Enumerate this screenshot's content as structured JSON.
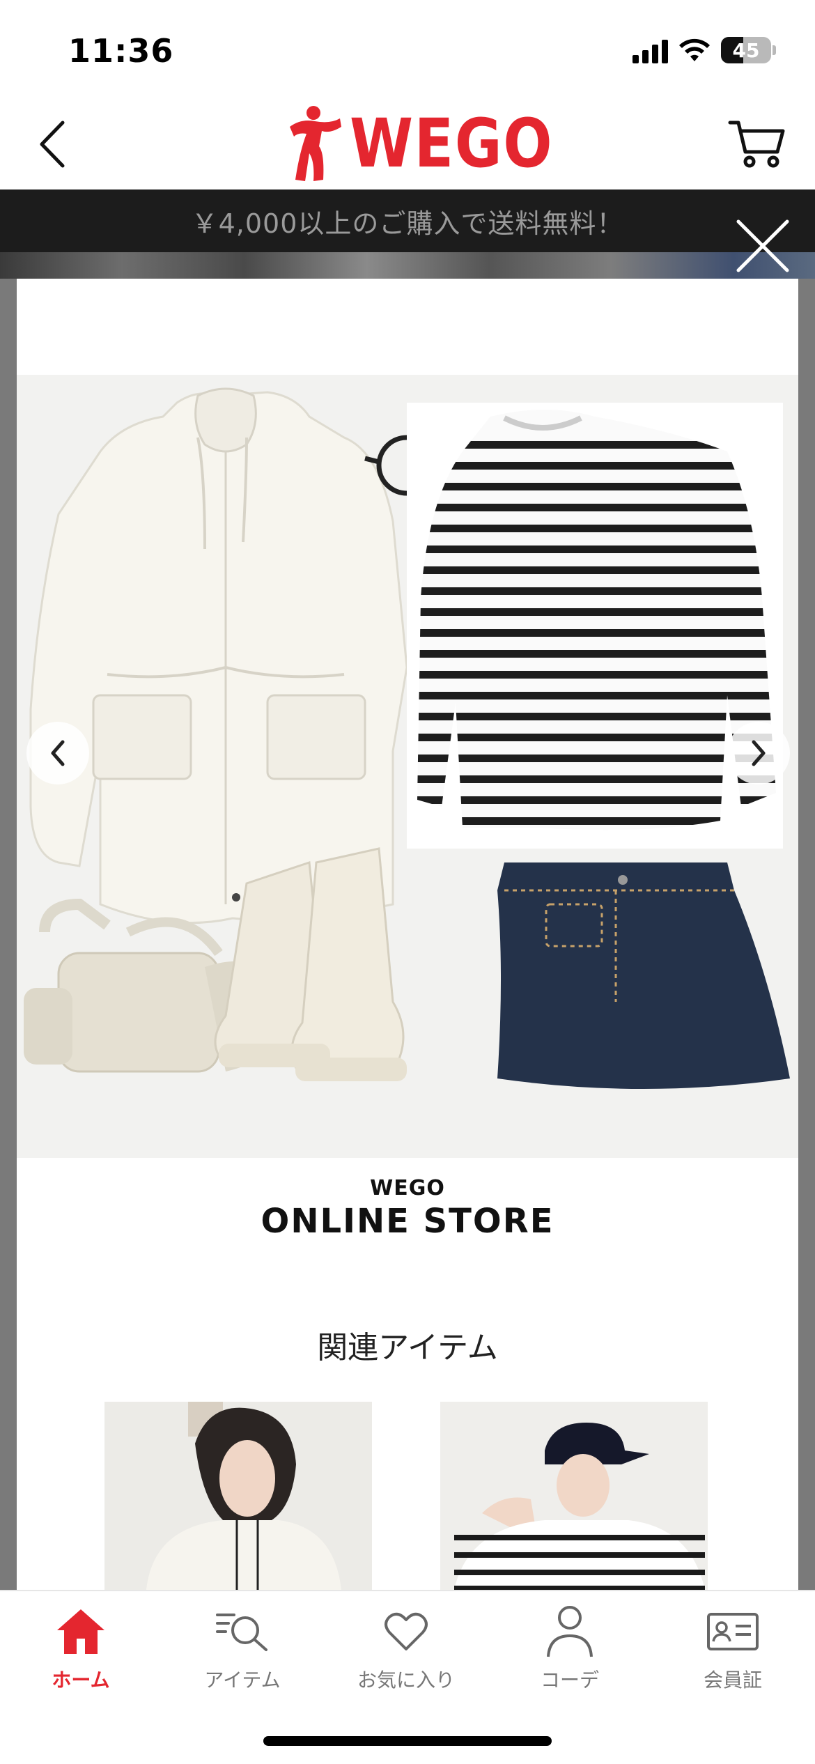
{
  "status_bar": {
    "time": "11:36",
    "battery": "45",
    "battery_level": 0.45
  },
  "header": {
    "logo_text": "WEGO",
    "back_icon": "chevron-left-icon",
    "cart_icon": "cart-icon",
    "logo_icon": "wego-runner-logo-icon"
  },
  "banner": {
    "text": "￥4,000以上のご購入で送料無料！"
  },
  "modal": {
    "close_icon": "close-icon",
    "prev_icon": "chevron-left-icon",
    "next_icon": "chevron-right-icon",
    "store_brand_small": "WEGO",
    "store_brand_big": "ONLINE STORE",
    "related_title": "関連アイテム"
  },
  "tab_bar": {
    "items": [
      {
        "label": "ホーム",
        "icon": "home-icon",
        "active": true
      },
      {
        "label": "アイテム",
        "icon": "item-search-icon",
        "active": false
      },
      {
        "label": "お気に入り",
        "icon": "heart-icon",
        "active": false
      },
      {
        "label": "コーデ",
        "icon": "person-icon",
        "active": false
      },
      {
        "label": "会員証",
        "icon": "member-card-icon",
        "active": false
      }
    ]
  },
  "colors": {
    "brand_red": "#e4262f",
    "banner_bg": "#1c1c1c",
    "tab_inactive": "#777777"
  }
}
